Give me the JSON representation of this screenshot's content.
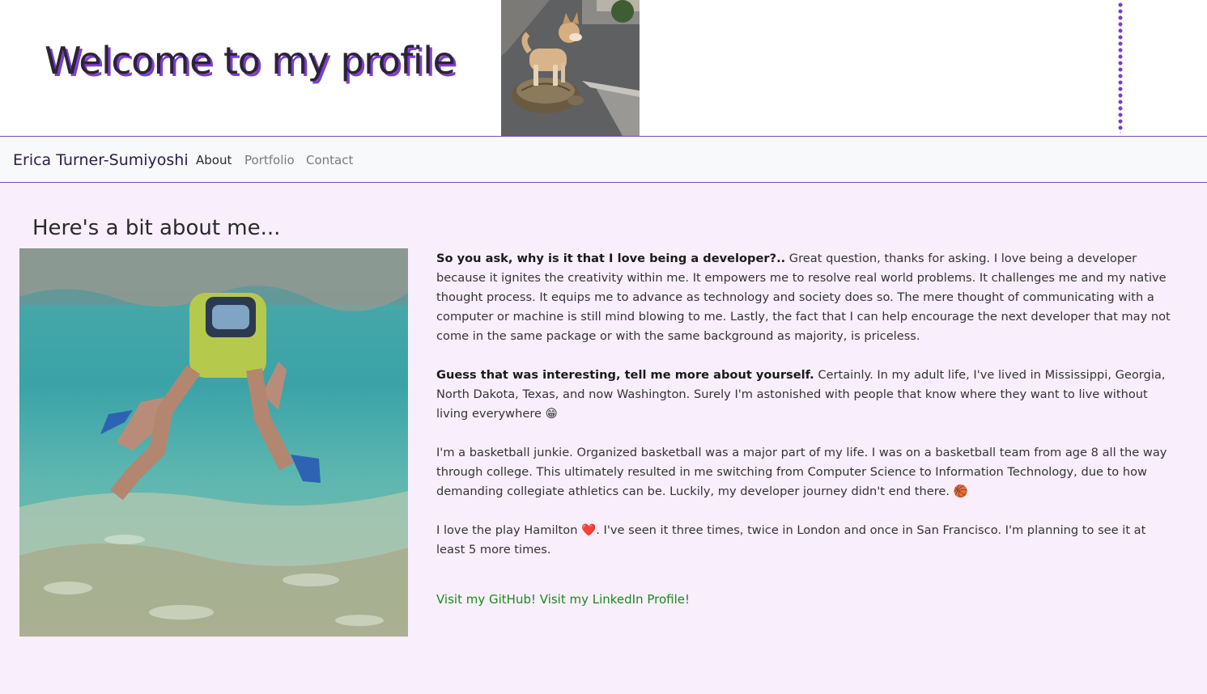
{
  "header": {
    "title": "Welcome to my profile"
  },
  "navbar": {
    "brand": "Erica Turner-Sumiyoshi",
    "links": [
      {
        "label": "About",
        "active": true
      },
      {
        "label": "Portfolio",
        "active": false
      },
      {
        "label": "Contact",
        "active": false
      }
    ]
  },
  "about": {
    "heading": "Here's a bit about me...",
    "p1_bold": "So you ask, why is it that I love being a developer?..",
    "p1_text": " Great question, thanks for asking. I love being a developer because it ignites the creativity within me. It empowers me to resolve real world problems. It challenges me and my native thought process. It equips me to advance as technology and society does so. The mere thought of communicating with a computer or machine is still mind blowing to me. Lastly, the fact that I can help encourage the next developer that may not come in the same package or with the same background as majority, is priceless.",
    "p2_bold": "Guess that was interesting, tell me more about yourself.",
    "p2_text": " Certainly. In my adult life, I've lived in Mississippi, Georgia, North Dakota, Texas, and now Washington. Surely I'm astonished with people that know where they want to live without living everywhere ",
    "p2_emoji": "😁",
    "p3_text": "I'm a basketball junkie. Organized basketball was a major part of my life. I was on a basketball team from age 8 all the way through college. This ultimately resulted in me switching from Computer Science to Information Technology, due to how demanding collegiate athletics can be. Luckily, my developer journey didn't end there. ",
    "p3_emoji": "🏀",
    "p4_text_a": "I love the play Hamilton ",
    "p4_emoji": "❤️",
    "p4_text_b": ". I've seen it three times, twice in London and once in San Francisco. I'm planning to see it at least 5 more times."
  },
  "links": {
    "github": "Visit my GitHub!",
    "linkedin": "Visit my LinkedIn Profile!"
  },
  "colors": {
    "page_bg": "#f9effc",
    "title_shadow": "#7d3fd1",
    "link": "#1a8a1a",
    "nav_border": "#7b49b0"
  }
}
